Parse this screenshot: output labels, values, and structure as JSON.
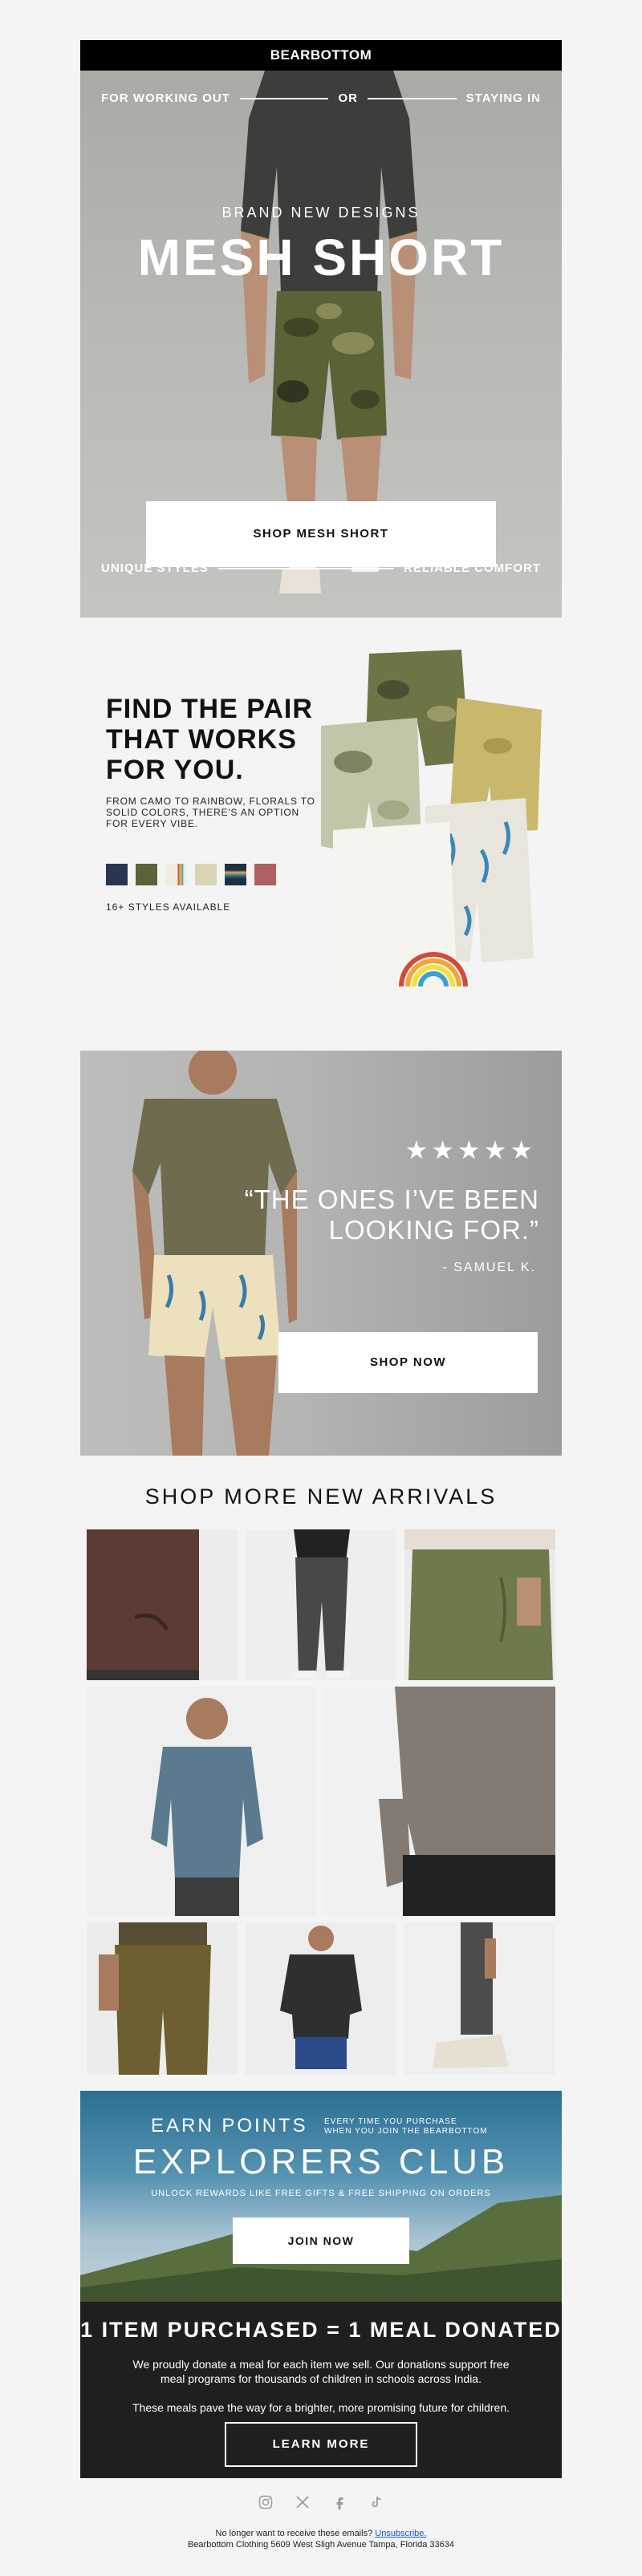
{
  "header": {
    "logo": "BEARBOTTOM"
  },
  "hero": {
    "left_top": "FOR WORKING OUT",
    "or": "OR",
    "right_top": "STAYING IN",
    "eyebrow": "BRAND NEW DESIGNS",
    "title": "MESH SHORT",
    "cta": "SHOP MESH SHORT",
    "left_bottom": "UNIQUE STYLES",
    "right_bottom": "RELIABLE COMFORT"
  },
  "pair": {
    "title_l1": "FIND THE PAIR",
    "title_l2": "THAT WORKS",
    "title_l3": "FOR YOU.",
    "description": "FROM CAMO TO RAINBOW, FLORALS TO SOLID COLORS, THERE'S AN OPTION FOR EVERY VIBE.",
    "swatch_colors": [
      "#2a3550",
      "#5a6438",
      "#e9e2d2",
      "#c9c6a2",
      "#3a6c8c",
      "#b06060"
    ],
    "styles_count": "16+ STYLES AVAILABLE"
  },
  "review": {
    "stars": "★★★★★",
    "quote": "“THE ONES I’VE BEEN LOOKING FOR.”",
    "author": "- SAMUEL K.",
    "cta": "SHOP NOW"
  },
  "arrivals": {
    "title": "SHOP MORE NEW ARRIVALS"
  },
  "club": {
    "earn": "EARN POINTS",
    "every_l1": "EVERY TIME YOU PURCHASE",
    "every_l2": "WHEN YOU JOIN THE BEARBOTTOM",
    "title": "EXPLORERS CLUB",
    "unlock": "UNLOCK REWARDS LIKE FREE GIFTS & FREE SHIPPING ON ORDERS",
    "cta": "JOIN NOW"
  },
  "meal": {
    "title": "1 ITEM PURCHASED = 1 MEAL DONATED",
    "p1": "We proudly donate a meal for each item we sell. Our donations support free meal programs for thousands of children in schools across India.",
    "p2": "These meals pave the way for a brighter, more promising future for children.",
    "cta": "LEARN MORE"
  },
  "footer": {
    "unsubscribe_prefix": "No longer want to receive these emails?",
    "unsubscribe_link": "Unsubscribe.",
    "address": "Bearbottom Clothing 5609 West Sligh Avenue Tampa, Florida 33634",
    "social_icons": [
      "instagram-icon",
      "x-icon",
      "facebook-icon",
      "tiktok-icon"
    ]
  }
}
